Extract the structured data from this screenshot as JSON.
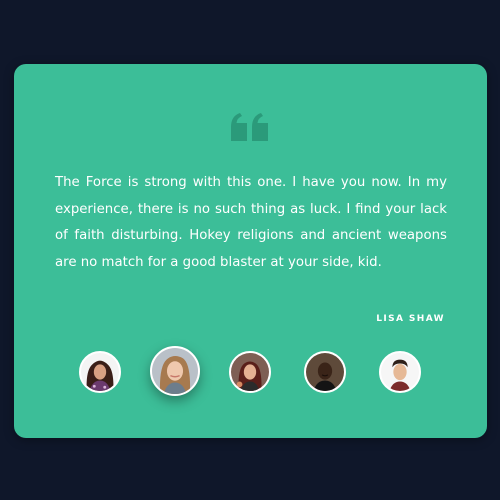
{
  "testimonial": {
    "icon": "quote-icon",
    "quote": "The Force is strong with this one. I have you now. In my experience, there is no such thing as luck. I find your lack of faith disturbing. Hokey religions and ancient weapons are no match for a good blaster at your side, kid.",
    "author": "LISA SHAW"
  },
  "avatars": [
    {
      "name": "avatar-1",
      "active": false
    },
    {
      "name": "avatar-2",
      "active": true
    },
    {
      "name": "avatar-3",
      "active": false
    },
    {
      "name": "avatar-4",
      "active": false
    },
    {
      "name": "avatar-5",
      "active": false
    }
  ],
  "colors": {
    "background": "#0f172a",
    "card": "#3cbe98",
    "quote_icon": "#2b9a7a",
    "text": "#ffffff"
  }
}
